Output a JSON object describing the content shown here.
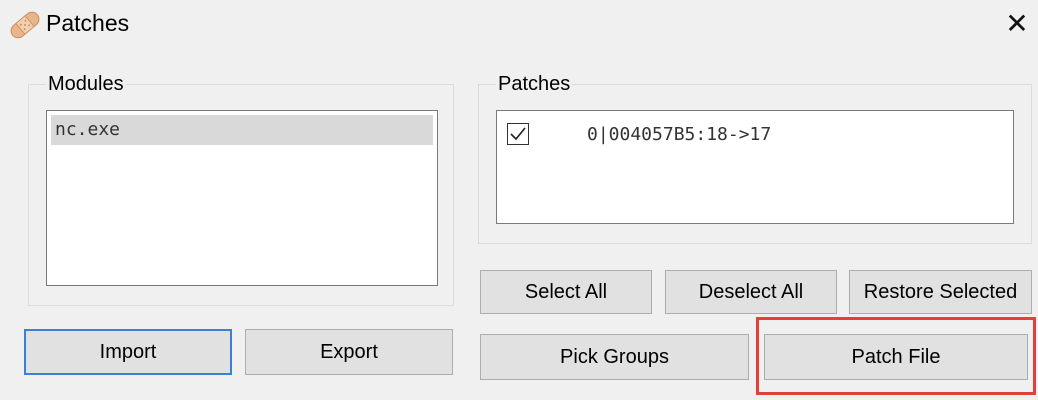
{
  "window": {
    "title": "Patches",
    "icon": "bandage-icon",
    "close_glyph": "✕"
  },
  "modules": {
    "group_label": "Modules",
    "items": [
      "nc.exe"
    ],
    "selected": "nc.exe"
  },
  "patches": {
    "group_label": "Patches",
    "items": [
      {
        "checked": true,
        "text": "0|004057B5:18->17"
      }
    ]
  },
  "buttons": {
    "import": "Import",
    "export": "Export",
    "select_all": "Select All",
    "deselect_all": "Deselect All",
    "restore_selected": "Restore Selected",
    "pick_groups": "Pick Groups",
    "patch_file": "Patch File"
  },
  "colors": {
    "highlight": "#e2413a",
    "default_button_border": "#3c7fd0"
  }
}
